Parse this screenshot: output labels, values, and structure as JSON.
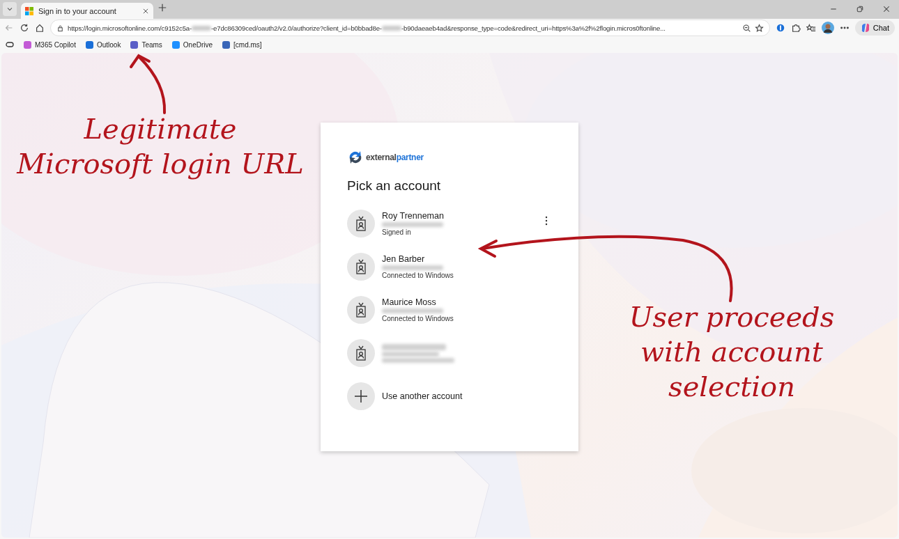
{
  "browser": {
    "tab": {
      "title": "Sign in to your account",
      "selected": true
    },
    "address_bar": {
      "segments": [
        {
          "kind": "text",
          "text": "https://login.microsoftonline.com/c9152c5a-"
        },
        {
          "kind": "redacted"
        },
        {
          "kind": "text",
          "text": "-e7dc86309ced/oauth2/v2.0/authorize?client_id=b0bbad8e-"
        },
        {
          "kind": "redacted"
        },
        {
          "kind": "text",
          "text": "-b90daeaeb4ad&response_type=code&redirect_uri=https%3a%2f%2flogin.micros0ftonline..."
        }
      ]
    },
    "chat_button": "Chat",
    "bookmarks": [
      "M365 Copilot",
      "Outlook",
      "Teams",
      "OneDrive",
      "[cmd.ms]"
    ]
  },
  "card": {
    "logo": {
      "brand_a": "external",
      "brand_b": "partner"
    },
    "title": "Pick an account",
    "accounts": [
      {
        "kind": "account",
        "name": "Roy Trenneman",
        "status": "Signed in",
        "menu": true
      },
      {
        "kind": "account",
        "name": "Jen Barber",
        "status": "Connected to Windows",
        "menu": false
      },
      {
        "kind": "account",
        "name": "Maurice Moss",
        "status": "Connected to Windows",
        "menu": false
      },
      {
        "kind": "redacted",
        "menu": false
      },
      {
        "kind": "add",
        "name": "Use another account",
        "menu": false
      }
    ]
  },
  "annotations": [
    {
      "text": "Legitimate Microsoft login URL"
    },
    {
      "text": "User proceeds with account selection"
    }
  ]
}
